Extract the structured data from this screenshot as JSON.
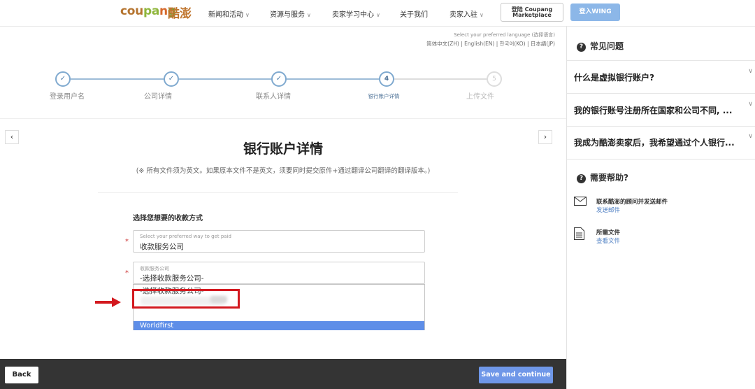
{
  "topnav": {
    "logo_text_parts": [
      "cou",
      "pa",
      "n",
      "g"
    ],
    "logo_cn": "酷澎",
    "items": [
      "新闻和活动",
      "资源与服务",
      "卖家学习中心",
      "关于我们",
      "卖家入驻"
    ],
    "login_coupang_line1": "登陆 Coupang",
    "login_coupang_line2": "Marketplace",
    "login_wing": "登入WING"
  },
  "lang": {
    "hint": "Select your preferred language (选择语言)",
    "links": "简体中文(ZH) | English(EN) | 한국어(KO) | 日本語(JP)"
  },
  "stepper": {
    "steps": [
      {
        "label": "登录用户名",
        "state": "done",
        "marker": "✓"
      },
      {
        "label": "公司详情",
        "state": "done",
        "marker": "✓"
      },
      {
        "label": "联系人详情",
        "state": "done",
        "marker": "✓"
      },
      {
        "label": "银行账户详情",
        "state": "active",
        "marker": "4"
      },
      {
        "label": "上传文件",
        "state": "todo",
        "marker": "5"
      }
    ]
  },
  "nav_arrows": {
    "prev": "‹",
    "next": "›"
  },
  "form": {
    "title": "银行账户详情",
    "subtitle": "(※ 所有文件须为英文。如果原本文件不是英文，须要同时提交原件+通过翻译公司翻译的翻译版本。)",
    "section_heading": "选择您想要的收款方式",
    "required_mark": "*",
    "payment_method": {
      "label": "Select your preferred way to get paid",
      "value": "收款服务公司"
    },
    "provider": {
      "label": "收款服务公司",
      "value": "-选择收款服务公司-",
      "options": [
        "-选择收款服务公司-",
        "Worldfirst"
      ],
      "highlighted": "Worldfirst"
    }
  },
  "bottombar": {
    "back": "Back",
    "save": "Save and continue"
  },
  "sidebar": {
    "faq_heading": "常见问题",
    "faq": [
      "什么是虚拟银行账户?",
      "我的银行账号注册所在国家和公司不同, ...",
      "我成为酷澎卖家后，我希望通过个人银行..."
    ],
    "help_heading": "需要帮助?",
    "help": [
      {
        "title": "联系酷澎的顾问并发送邮件",
        "link": "发送邮件"
      },
      {
        "title": "所需文件",
        "link": "查看文件"
      }
    ]
  },
  "colors": {
    "accent": "#5e8ee8",
    "highlight_red": "#d3191f",
    "bottombar": "#343434"
  }
}
